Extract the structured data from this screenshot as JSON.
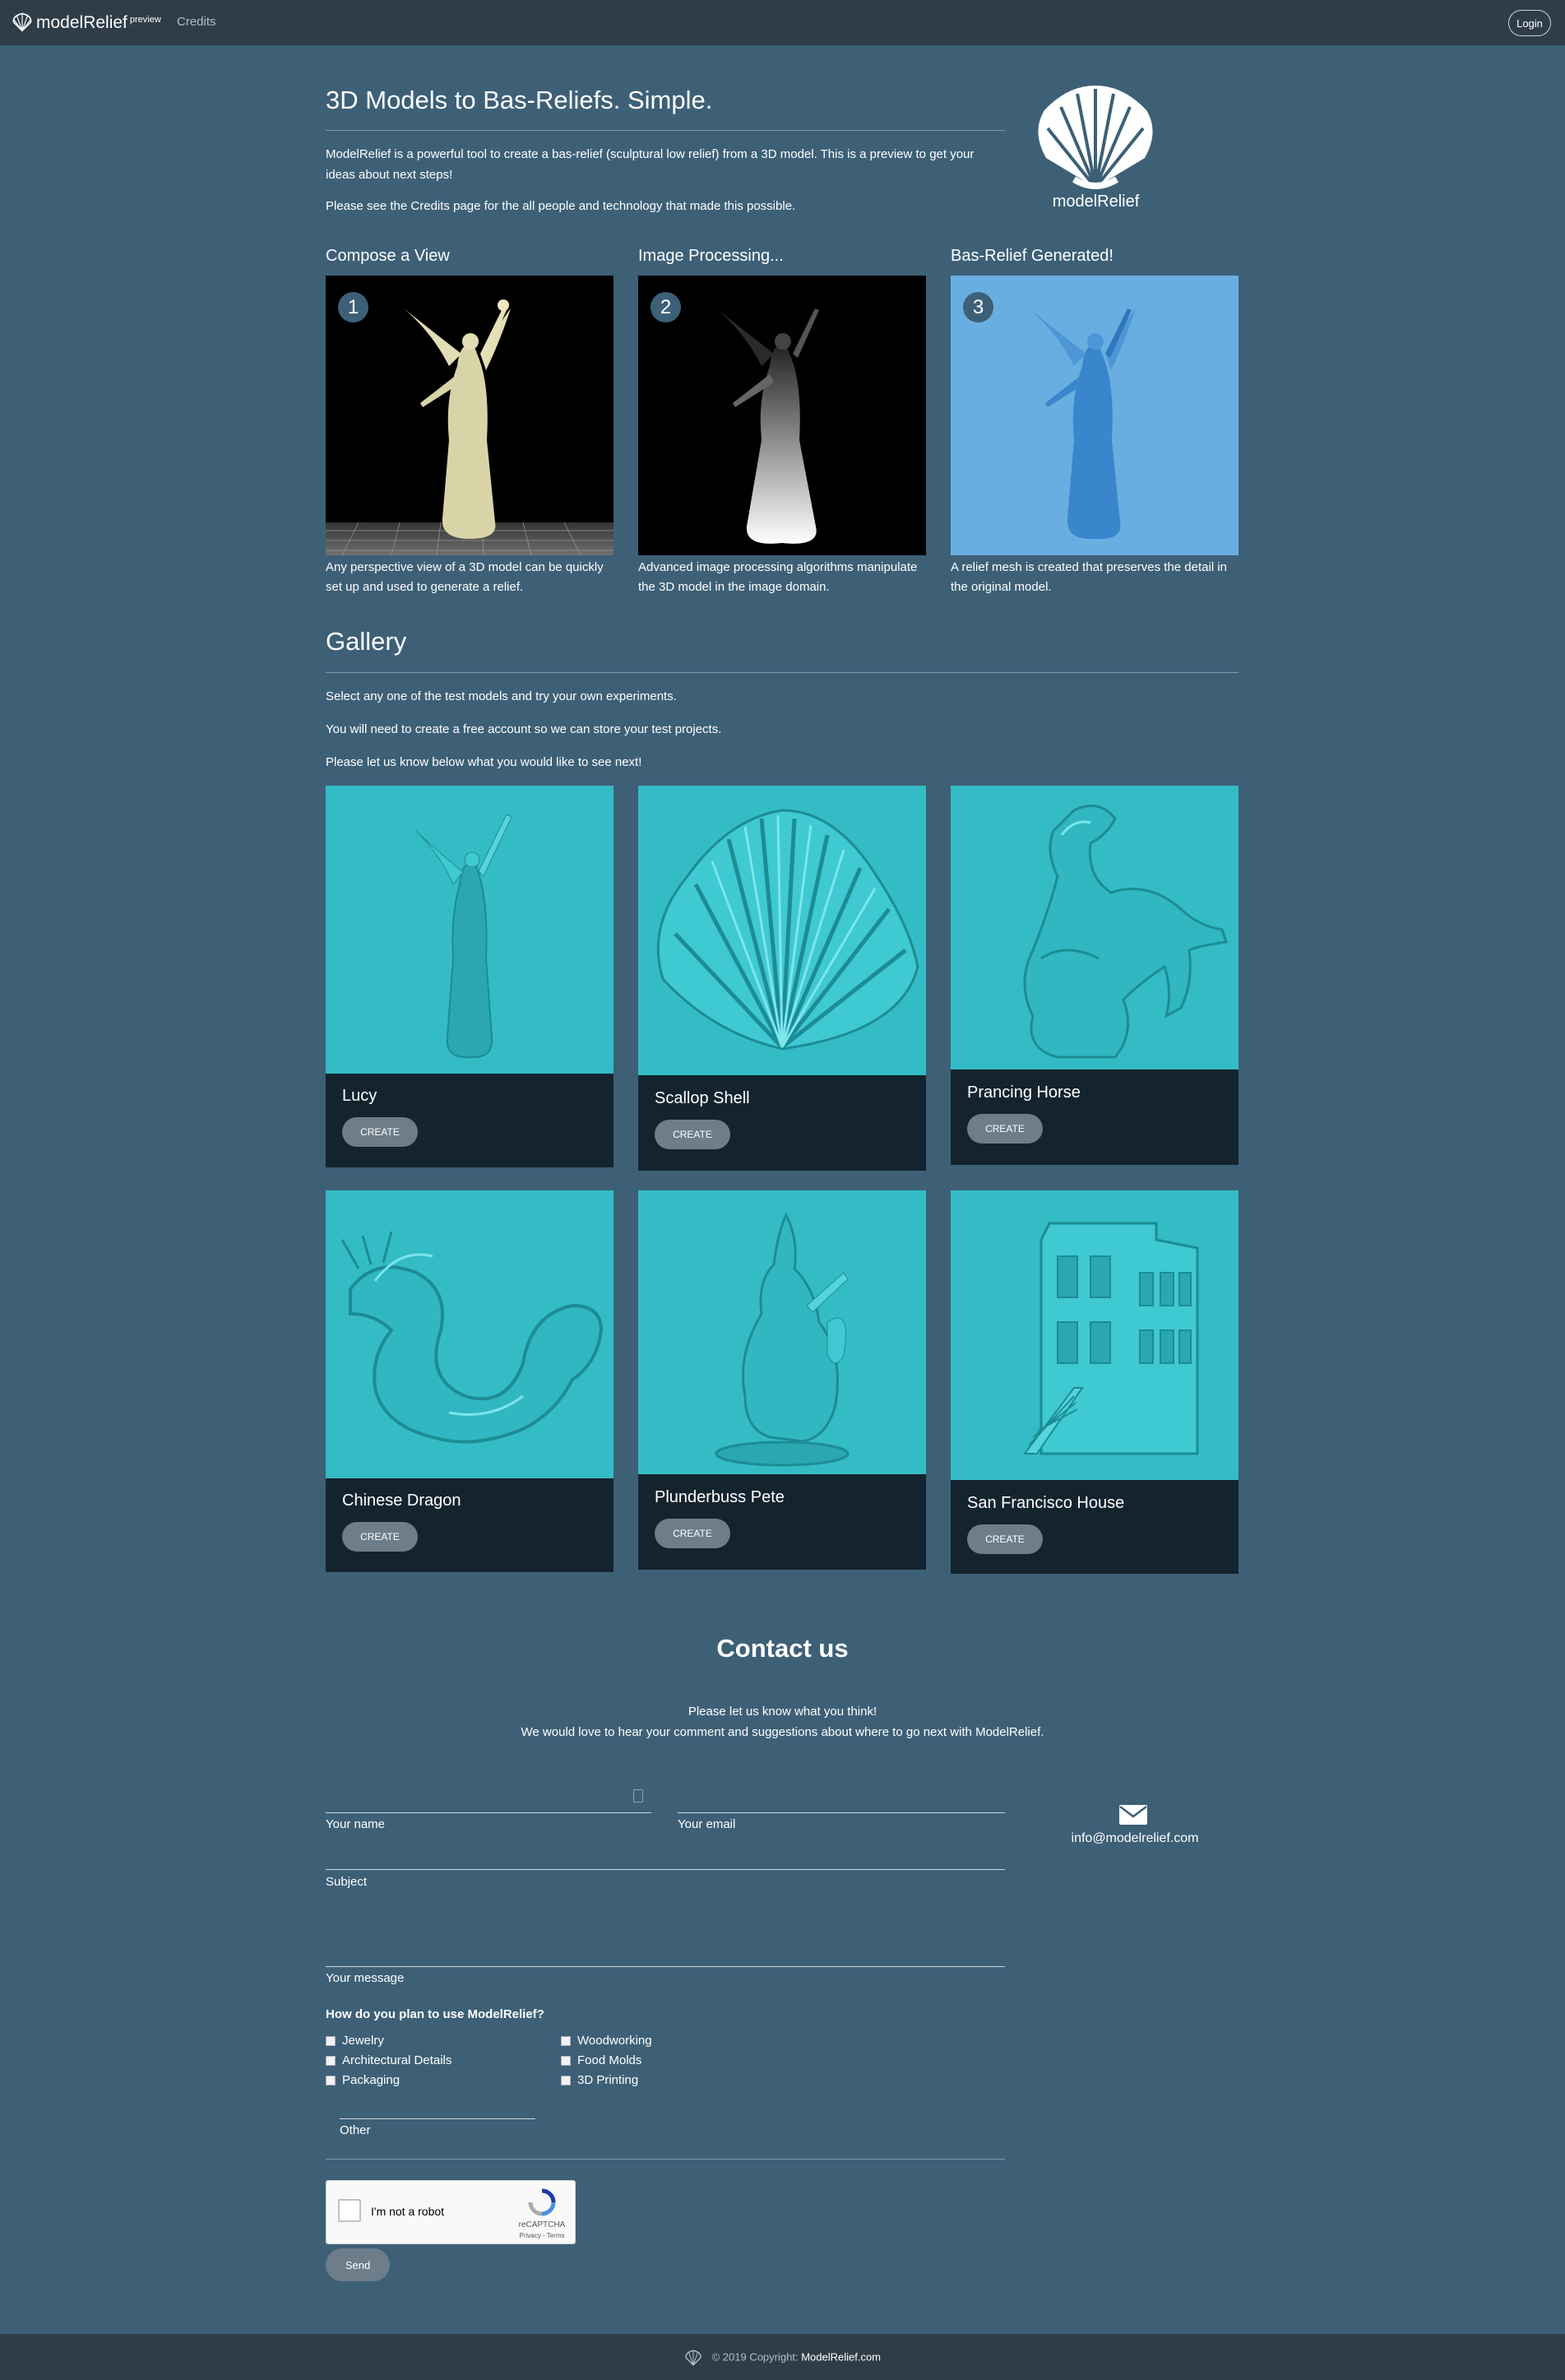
{
  "navbar": {
    "brand": "modelRelief",
    "brand_sup": "preview",
    "links": [
      "Credits"
    ],
    "login": "Login"
  },
  "hero": {
    "title": "3D Models to Bas-Reliefs. Simple.",
    "p1": "ModelRelief is a powerful tool to create a bas-relief (sculptural low relief) from a 3D model. This is a preview to get your ideas about next steps!",
    "p2": "Please see the Credits page for the all people and technology that made this possible.",
    "logo_text": "modelRelief"
  },
  "steps": [
    {
      "title": "Compose a View",
      "num": "1",
      "desc": "Any perspective view of a 3D model can be quickly set up and used to generate a relief."
    },
    {
      "title": "Image Processing...",
      "num": "2",
      "desc": "Advanced image processing algorithms manipulate the 3D model in the image domain."
    },
    {
      "title": "Bas-Relief Generated!",
      "num": "3",
      "desc": "A relief mesh is created that preserves the detail in the original model."
    }
  ],
  "gallery": {
    "title": "Gallery",
    "p1": "Select any one of the test models and try your own experiments.",
    "p2": "You will need to create a free account so we can store your test projects.",
    "p3": "Please let us know below what you would like to see next!",
    "button": "CREATE",
    "items": [
      {
        "name": "Lucy"
      },
      {
        "name": "Scallop Shell"
      },
      {
        "name": "Prancing Horse"
      },
      {
        "name": "Chinese Dragon"
      },
      {
        "name": "Plunderbuss Pete"
      },
      {
        "name": "San Francisco House"
      }
    ]
  },
  "contact": {
    "title": "Contact us",
    "p1": "Please let us know what you think!",
    "p2": "We would love to hear your comment and suggestions about where to go next with ModelRelief.",
    "name_label": "Your name",
    "email_label": "Your email",
    "subject_label": "Subject",
    "message_label": "Your message",
    "email_address": "info@modelrelief.com",
    "use_title": "How do you plan to use ModelRelief?",
    "uses_left": [
      "Jewelry",
      "Architectural Details",
      "Packaging"
    ],
    "uses_right": [
      "Woodworking",
      "Food Molds",
      "3D Printing"
    ],
    "other_label": "Other",
    "recaptcha_label": "I'm not a robot",
    "recaptcha_brand": "reCAPTCHA",
    "recaptcha_terms": "Privacy - Terms",
    "send": "Send"
  },
  "footer": {
    "copyright": "© 2019 Copyright: ",
    "brand": "ModelRelief.com"
  },
  "colors": {
    "page_bg": "#3d6077",
    "navbar_bg": "#2f3d49",
    "card_bg": "#14242f",
    "relief_teal": "#34bcc6",
    "button_gray": "#6d7d8a"
  }
}
